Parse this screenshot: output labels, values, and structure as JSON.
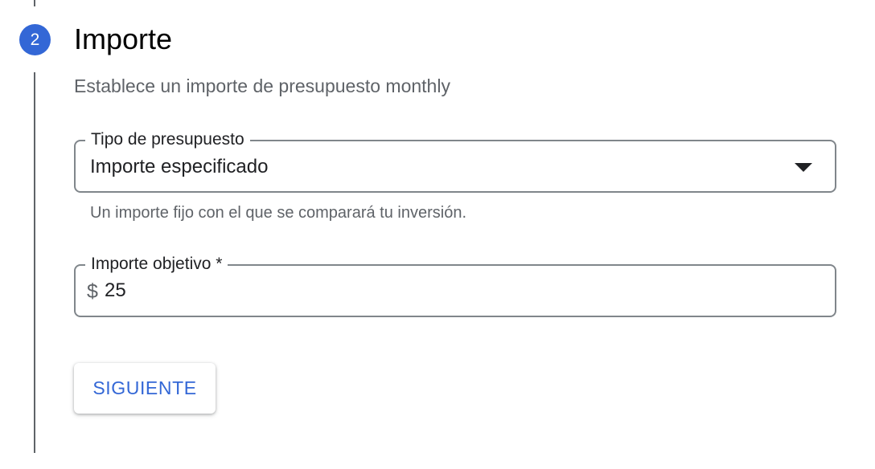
{
  "step": {
    "number": "2",
    "title": "Importe",
    "description": "Establece un importe de presupuesto monthly"
  },
  "budget_type": {
    "label": "Tipo de presupuesto",
    "selected": "Importe especificado",
    "hint": "Un importe fijo con el que se comparará tu inversión.",
    "icon": "arrow-drop-down-icon"
  },
  "target_amount": {
    "label": "Importe objetivo *",
    "currency_symbol": "$",
    "value": "25"
  },
  "actions": {
    "next_label": "SIGUIENTE"
  },
  "colors": {
    "accent": "#3367d6",
    "rail": "#5f6368",
    "field_border": "#80868b",
    "secondary_text": "#5f6368"
  }
}
